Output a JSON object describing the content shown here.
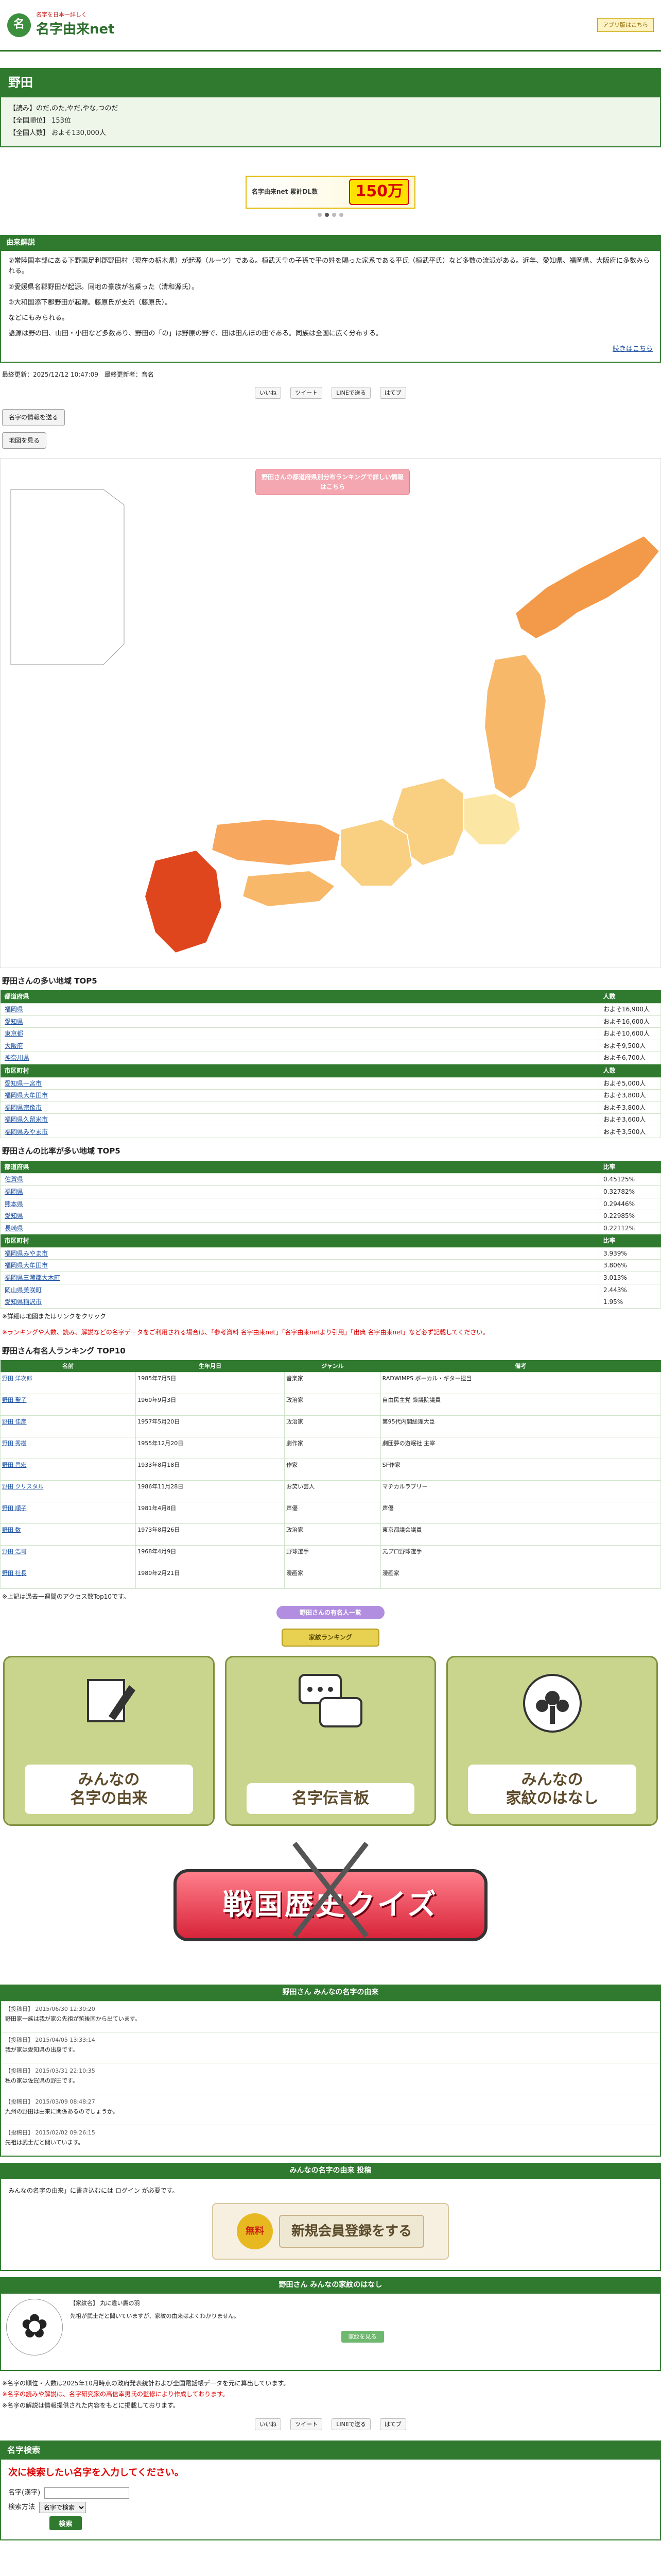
{
  "site": {
    "sub": "名字を日本一詳しく",
    "name": "名字由来net",
    "badge": "アプリ版はこちら"
  },
  "surname": {
    "title": "野田",
    "reading": "【読み】のだ,のた,やだ,やな,つのだ",
    "rank": "【全国順位】 153位",
    "count": "【全国人数】 およそ130,000人"
  },
  "ad": {
    "left": "名字由来net 累計DL数",
    "num": "150万"
  },
  "origin": {
    "heading": "由来解説",
    "p1": "②常陸国本部にある下野国足利郡野田村（現在の栃木県）が起源（ルーツ）である。桓武天皇の子孫で平の姓を賜った家系である平氏（桓武平氏）など多数の流派がある。近年、愛知県、福岡県、大阪府に多数みられる。",
    "p2": "②愛媛県名郡野田が起源。同地の豪族が名乗った（清和源氏）。",
    "p3": "②大和国添下郡野田が起源。藤原氏が支流（藤原氏）。",
    "p4": "などにもみられる。",
    "p5": "語源は野の田、山田・小田など多数あり、野田の「の」は野原の野で、田は田んぼの田である。同族は全国に広く分布する。",
    "more": "続きはこちら"
  },
  "dates": "最終更新：2025/12/12 10:47:09　最終更新者：音名",
  "share": [
    "いいね",
    "ツイート",
    "LINEで送る",
    "はてブ"
  ],
  "buttons": {
    "gen": "名字の情報を送る",
    "map": "地図を見る"
  },
  "map": {
    "pink": "野田さんの都道府県別分布ランキングで詳しい情報はこちら"
  },
  "pref_top": {
    "title": "野田さんの多い地域 TOP5",
    "h1": "都道府県",
    "h2": "人数",
    "rows": [
      [
        "福岡県",
        "およそ16,900人"
      ],
      [
        "愛知県",
        "およそ16,600人"
      ],
      [
        "東京都",
        "およそ10,600人"
      ],
      [
        "大阪府",
        "およそ9,500人"
      ],
      [
        "神奈川県",
        "およそ6,700人"
      ]
    ],
    "ch": "市区町村",
    "rows2": [
      [
        "愛知県一宮市",
        "およそ5,000人"
      ],
      [
        "福岡県大牟田市",
        "およそ3,800人"
      ],
      [
        "福岡県宗像市",
        "およそ3,800人"
      ],
      [
        "福岡県久留米市",
        "およそ3,600人"
      ],
      [
        "福岡県みやま市",
        "およそ3,500人"
      ]
    ]
  },
  "ratio_top": {
    "title": "野田さんの比率が多い地域 TOP5",
    "h1": "都道府県",
    "h2": "比率",
    "rows": [
      [
        "佐賀県",
        "0.45125%"
      ],
      [
        "福岡県",
        "0.32782%"
      ],
      [
        "熊本県",
        "0.29446%"
      ],
      [
        "愛知県",
        "0.22985%"
      ],
      [
        "長崎県",
        "0.22112%"
      ]
    ],
    "ch": "市区町村",
    "rows2": [
      [
        "福岡県みやま市",
        "3.939%"
      ],
      [
        "福岡県大牟田市",
        "3.806%"
      ],
      [
        "福岡県三瀦郡大木町",
        "3.013%"
      ],
      [
        "岡山県美咲町",
        "2.443%"
      ],
      [
        "愛知県稲沢市",
        "1.95%"
      ]
    ]
  },
  "note1": "※詳細は地図またはリンクをクリック",
  "red_note": "※ランキングや人数、読み、解説などの名字データをご利用される場合は、「参考資料 名字由来net」「名字由来netより引用」「出典 名字由来net」など必ず記載してください。",
  "famous": {
    "title": "野田さん有名人ランキング TOP10",
    "heads": [
      "名前",
      "生年月日",
      "ジャンル",
      "備考"
    ],
    "rows": [
      [
        "野田 洋次郎",
        "1985年7月5日",
        "音楽家",
        "RADWIMPS ボーカル・ギター担当"
      ],
      [
        "野田 聖子",
        "1960年9月3日",
        "政治家",
        "自由民主党 衆議院議員"
      ],
      [
        "野田 佳彦",
        "1957年5月20日",
        "政治家",
        "第95代内閣総理大臣"
      ],
      [
        "野田 秀樹",
        "1955年12月20日",
        "劇作家",
        "劇団夢の遊眠社 主宰"
      ],
      [
        "野田 昌宏",
        "1933年8月18日",
        "作家",
        "SF作家"
      ],
      [
        "野田 クリスタル",
        "1986年11月28日",
        "お笑い芸人",
        "マヂカルラブリー"
      ],
      [
        "野田 順子",
        "1981年4月8日",
        "声優",
        "声優"
      ],
      [
        "野田 数",
        "1973年8月26日",
        "政治家",
        "東京都議会議員"
      ],
      [
        "野田 浩司",
        "1968年4月9日",
        "野球選手",
        "元プロ野球選手"
      ],
      [
        "野田 社長",
        "1980年2月21日",
        "漫画家",
        "漫画家"
      ]
    ]
  },
  "note2": "※上記は過去一週間のアクセス数Top10です。",
  "pill": "野田さんの有名人一覧",
  "kamon_btn": "家紋ランキング",
  "tiles": [
    "みんなの\n名字の由来",
    "名字伝言板",
    "みんなの\n家紋のはなし"
  ],
  "quiz": "戦国歴史クイズ",
  "board": {
    "title": "野田さん みんなの名字の由来",
    "posts": [
      [
        "【投稿日】 2015/06/30 12:30:20",
        "野田家一族は我が家の先祖が筑後国から出ています。"
      ],
      [
        "【投稿日】 2015/04/05 13:33:14",
        "我が家は愛知県の出身です。"
      ],
      [
        "【投稿日】 2015/03/31 22:10:35",
        "私の家は佐賀県の野田です。"
      ],
      [
        "【投稿日】 2015/03/09 08:48:27",
        "九州の野田は由来に関係あるのでしょうか。"
      ],
      [
        "【投稿日】 2015/02/02 09:26:15",
        "先祖は武士だと聞いています。"
      ]
    ]
  },
  "reg": {
    "title": "みんなの名字の由来 投稿",
    "text": "みんなの名字の由来」に書き込むには ログイン が必要です。",
    "badge": "無料",
    "btn": "新規会員登録をする"
  },
  "kamon": {
    "title": "野田さん みんなの家紋のはなし",
    "text": "【家紋名】 丸に違い鷹の羽",
    "text2": "先祖が武士だと聞いていますが、家紋の由来はよくわかりません。",
    "pill": "家紋を見る"
  },
  "foot": {
    "r1": "※名字の順位・人数は2025年10月時点の政府発表統計および全国電話帳データを元に算出しています。",
    "r2": "※名字の読みや解説は、名字研究家の高信幸男氏の監修により作成しております。",
    "r3": "※名字の解説は情報提供された内容をもとに掲載しております。"
  },
  "search": {
    "title": "名字検索",
    "red": "次に検索したい名字を入力してください。",
    "label1": "名字(漢字)",
    "label2": "検索方法",
    "option": "名字で検索",
    "go": "検索"
  }
}
